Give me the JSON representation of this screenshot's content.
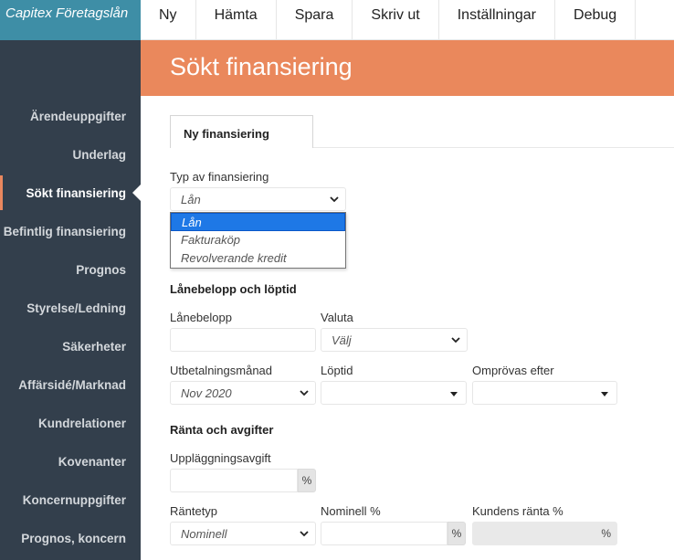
{
  "brand": {
    "name": "Capitex Företagslån"
  },
  "topnav": {
    "items": [
      "Ny",
      "Hämta",
      "Spara",
      "Skriv ut",
      "Inställningar",
      "Debug"
    ]
  },
  "sidebar": {
    "items": [
      "Ärendeuppgifter",
      "Underlag",
      "Sökt finansiering",
      "Befintlig finansiering",
      "Prognos",
      "Styrelse/Ledning",
      "Säkerheter",
      "Affärsidé/Marknad",
      "Kundrelationer",
      "Kovenanter",
      "Koncernuppgifter",
      "Prognos, koncern"
    ],
    "active_index": 2
  },
  "page": {
    "title": "Sökt finansiering"
  },
  "tabs": [
    {
      "label": "Ny finansiering"
    }
  ],
  "form": {
    "typ": {
      "label": "Typ av finansiering",
      "value": "Lån",
      "options": [
        "Lån",
        "Fakturaköp",
        "Revolverande kredit"
      ]
    },
    "section_loan": "Lånebelopp och löptid",
    "lanebelopp": {
      "label": "Lånebelopp",
      "value": ""
    },
    "valuta": {
      "label": "Valuta",
      "value": "Välj"
    },
    "utbetalningsmanad": {
      "label": "Utbetalningsmånad",
      "value": "Nov 2020"
    },
    "loptid": {
      "label": "Löptid",
      "value": ""
    },
    "omprovas": {
      "label": "Omprövas efter",
      "value": ""
    },
    "section_ranta": "Ränta och avgifter",
    "upplaggningsavgift": {
      "label": "Uppläggningsavgift",
      "value": "",
      "unit": "%"
    },
    "rantetyp": {
      "label": "Räntetyp",
      "value": "Nominell"
    },
    "nominell": {
      "label": "Nominell %",
      "value": "",
      "unit": "%"
    },
    "kundens_ranta": {
      "label": "Kundens ränta %",
      "value": "",
      "unit": "%"
    }
  },
  "colors": {
    "brand_bg": "#3e8ea6",
    "sidebar_bg": "#333f4c",
    "header_bg": "#ea885c",
    "accent": "#e9875e",
    "selected_option": "#1e78e6"
  }
}
